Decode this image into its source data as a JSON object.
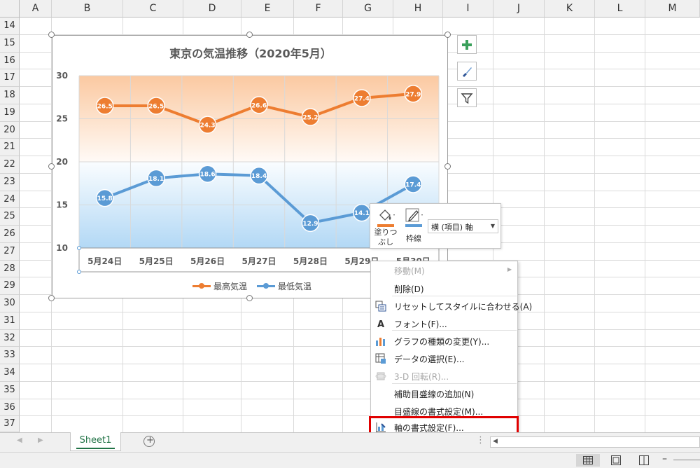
{
  "columns": [
    "A",
    "B",
    "C",
    "D",
    "E",
    "F",
    "G",
    "H",
    "I",
    "J",
    "K",
    "L",
    "M"
  ],
  "rows": [
    "14",
    "15",
    "16",
    "17",
    "18",
    "19",
    "20",
    "21",
    "22",
    "23",
    "24",
    "25",
    "26",
    "27",
    "28",
    "29",
    "30",
    "31",
    "32",
    "33",
    "34",
    "35",
    "36",
    "37"
  ],
  "chart_data": {
    "type": "line",
    "title": "東京の気温推移（2020年5月）",
    "categories": [
      "5月24日",
      "5月25日",
      "5月26日",
      "5月27日",
      "5月28日",
      "5月29日",
      "5月30日"
    ],
    "x_tick_labels_visible": [
      "5月24日",
      "5月25日",
      "5月26日",
      "5月27日",
      "5月28日",
      "5月29日",
      "5月30日"
    ],
    "ylim": [
      10,
      30
    ],
    "yticks": [
      "30",
      "25",
      "20",
      "15",
      "10"
    ],
    "yticks_values": [
      30,
      25,
      20,
      15,
      10
    ],
    "legend_position": "bottom",
    "grid": true,
    "series": [
      {
        "name": "最高気温",
        "color": "#ed7d31",
        "values": [
          26.5,
          26.5,
          24.3,
          26.6,
          25.2,
          27.4,
          27.9
        ]
      },
      {
        "name": "最低気温",
        "color": "#5b9bd5",
        "values": [
          15.8,
          18.1,
          18.6,
          18.4,
          12.9,
          14.1,
          17.4
        ]
      }
    ]
  },
  "minitoolbar": {
    "fill_label_1": "塗りつ",
    "fill_label_2": "ぶし",
    "outline_label": "枠線",
    "selector_value": "横 (項目) 軸"
  },
  "context_menu": {
    "items": [
      {
        "label": "移動(M)",
        "disabled": true,
        "submenu": true,
        "icon": ""
      },
      {
        "label": "削除(D)",
        "disabled": false,
        "icon": ""
      },
      {
        "label": "リセットしてスタイルに合わせる(A)",
        "disabled": false,
        "icon": "reset-style-icon"
      },
      {
        "label": "フォント(F)...",
        "disabled": false,
        "icon": "font-icon"
      },
      {
        "label": "グラフの種類の変更(Y)...",
        "disabled": false,
        "icon": "chart-type-icon"
      },
      {
        "label": "データの選択(E)...",
        "disabled": false,
        "icon": "select-data-icon"
      },
      {
        "label": "3-D 回転(R)...",
        "disabled": true,
        "icon": "rotate-3d-icon"
      },
      {
        "label": "補助目盛線の追加(N)",
        "disabled": false,
        "icon": ""
      },
      {
        "label": "目盛線の書式設定(M)...",
        "disabled": false,
        "icon": ""
      },
      {
        "label": "軸の書式設定(F)...",
        "disabled": false,
        "icon": "format-axis-icon",
        "highlighted": true
      }
    ]
  },
  "sheet_tab": "Sheet1",
  "highlight_color": "#e00000"
}
